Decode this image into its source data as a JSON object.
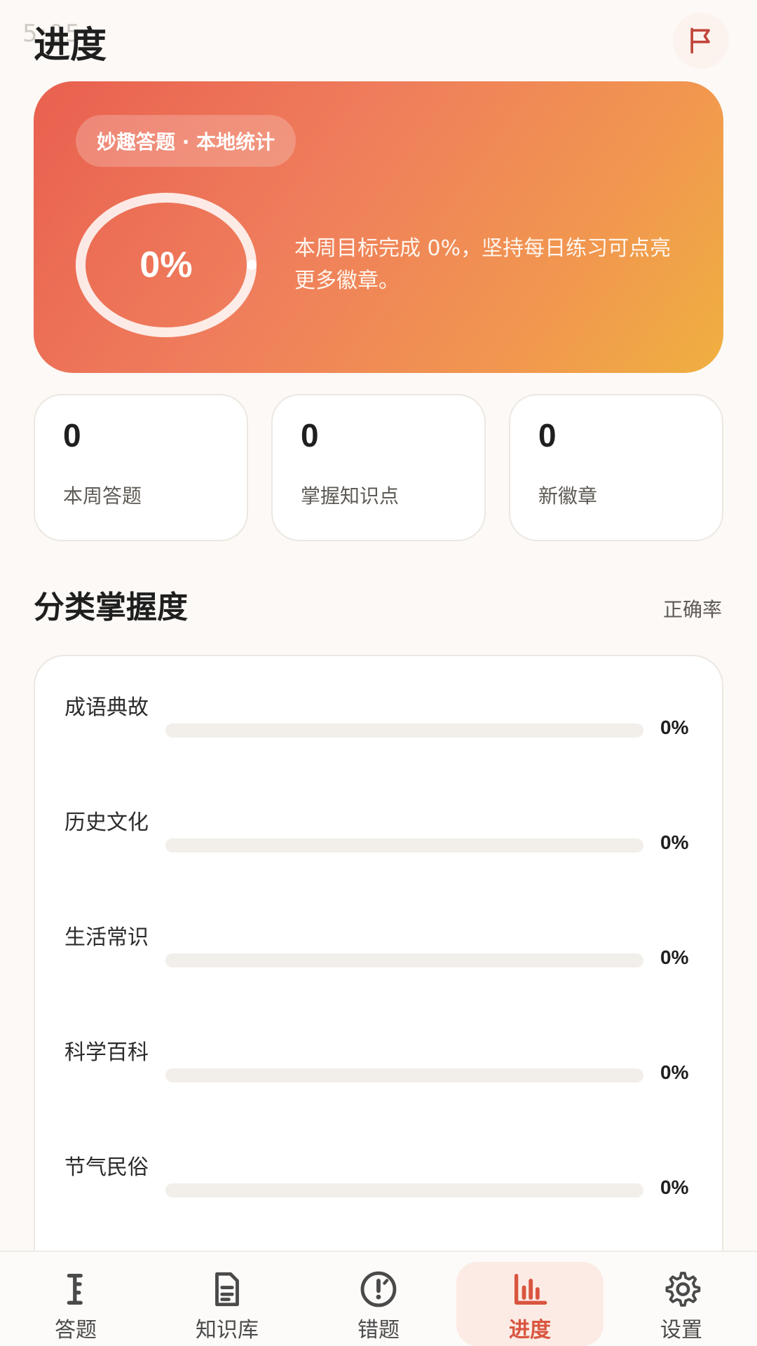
{
  "status_bar": {
    "time": "5:05"
  },
  "header": {
    "title": "进度"
  },
  "hero": {
    "badge": "妙趣答题 · 本地统计",
    "ring_value": "0%",
    "ring_progress": 0,
    "description": "本周目标完成 0%，坚持每日练习可点亮更多徽章。"
  },
  "stats": [
    {
      "value": "0",
      "label": "本周答题"
    },
    {
      "value": "0",
      "label": "掌握知识点"
    },
    {
      "value": "0",
      "label": "新徽章"
    }
  ],
  "section": {
    "title": "分类掌握度",
    "action": "正确率"
  },
  "categories": [
    {
      "name": "成语典故",
      "percent_label": "0%",
      "progress": 0
    },
    {
      "name": "历史文化",
      "percent_label": "0%",
      "progress": 0
    },
    {
      "name": "生活常识",
      "percent_label": "0%",
      "progress": 0
    },
    {
      "name": "科学百科",
      "percent_label": "0%",
      "progress": 0
    },
    {
      "name": "节气民俗",
      "percent_label": "0%",
      "progress": 0
    }
  ],
  "nav": [
    {
      "label": "答题",
      "icon": "quiz-icon",
      "active": false
    },
    {
      "label": "知识库",
      "icon": "document-icon",
      "active": false
    },
    {
      "label": "错题",
      "icon": "alert-icon",
      "active": false
    },
    {
      "label": "进度",
      "icon": "bar-chart-icon",
      "active": true
    },
    {
      "label": "设置",
      "icon": "gear-icon",
      "active": false
    }
  ],
  "colors": {
    "accent": "#d9553f",
    "hero_start": "#e9604f",
    "hero_end": "#f0b040",
    "background": "#fcf9f6"
  }
}
